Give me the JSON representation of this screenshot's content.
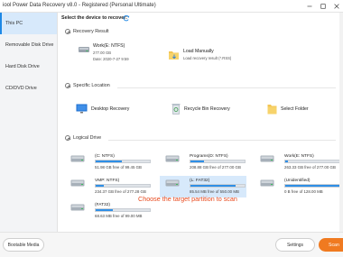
{
  "window": {
    "title": "iool Power Data Recovery v8.0 - Registered (Personal Ultimate)",
    "controls": [
      "minimize",
      "maximize",
      "close"
    ]
  },
  "sidebar": {
    "items": [
      {
        "label": "This PC",
        "icon": "this-pc-icon",
        "active": true
      },
      {
        "label": "Removable Disk Drive",
        "icon": "removable-disk-icon",
        "active": false
      },
      {
        "label": "Hard Disk Drive",
        "icon": "hard-disk-icon",
        "active": false
      },
      {
        "label": "CD/DVD Drive",
        "icon": "cd-dvd-icon",
        "active": false
      }
    ]
  },
  "main": {
    "select_title": "Select the device to recover:",
    "recovery_result": {
      "heading": "Recovery Result",
      "items": [
        {
          "name": "Work(E: NTFS)",
          "line1": "277.00 GB",
          "line2": "Date: 2020-7-27 9:59",
          "icon": "drive-result-icon"
        },
        {
          "name": "Load Manually",
          "line1": "Load recovery result (*.RSS)",
          "line2": "",
          "icon": "load-folder-icon"
        }
      ]
    },
    "specific_location": {
      "heading": "Specific Location",
      "items": [
        {
          "label": "Desktop Recovery",
          "icon": "desktop-icon"
        },
        {
          "label": "Recycle Bin Recovery",
          "icon": "recycle-bin-icon"
        },
        {
          "label": "Select Folder",
          "icon": "folder-icon"
        }
      ]
    },
    "logical_drive": {
      "heading": "Logical Drive",
      "drives": [
        {
          "name": "(C: NTFS)",
          "free": "51.98 GB free of 99.45 GB",
          "used_fraction": 0.48,
          "selected": false
        },
        {
          "name": "Programs(D: NTFS)",
          "free": "208.88 GB free of 277.00 GB",
          "used_fraction": 0.25,
          "selected": false
        },
        {
          "name": "Work(E: NTFS)",
          "free": "263.33 GB free of 277.00 GB",
          "used_fraction": 0.05,
          "selected": false
        },
        {
          "name": "VMP: NTFS)",
          "free": "234.37 GB free of 277.28 GB",
          "used_fraction": 0.15,
          "selected": false
        },
        {
          "name": "(L: FAT32)",
          "free": "85.54 MB free of 550.00 MB",
          "used_fraction": 0.84,
          "selected": true
        },
        {
          "name": "(Unidentified)",
          "free": "0 B free of 128.00 MB",
          "used_fraction": 1.0,
          "selected": false
        },
        {
          "name": "(FAT32)",
          "free": "68.63 MB free of 99.00 MB",
          "used_fraction": 0.31,
          "selected": false
        }
      ]
    },
    "annotation": "Choose the target partition to scan"
  },
  "footer": {
    "bootable_label": "Bootable Media",
    "settings_label": "Settings",
    "scan_label": "Scan"
  },
  "colors": {
    "accent_blue": "#1e88e5",
    "usage_bar": "#2f8fe6",
    "selected_bg": "#d7e9fb",
    "scan_orange": "#f07a20",
    "annotation_red": "#e8491d"
  }
}
